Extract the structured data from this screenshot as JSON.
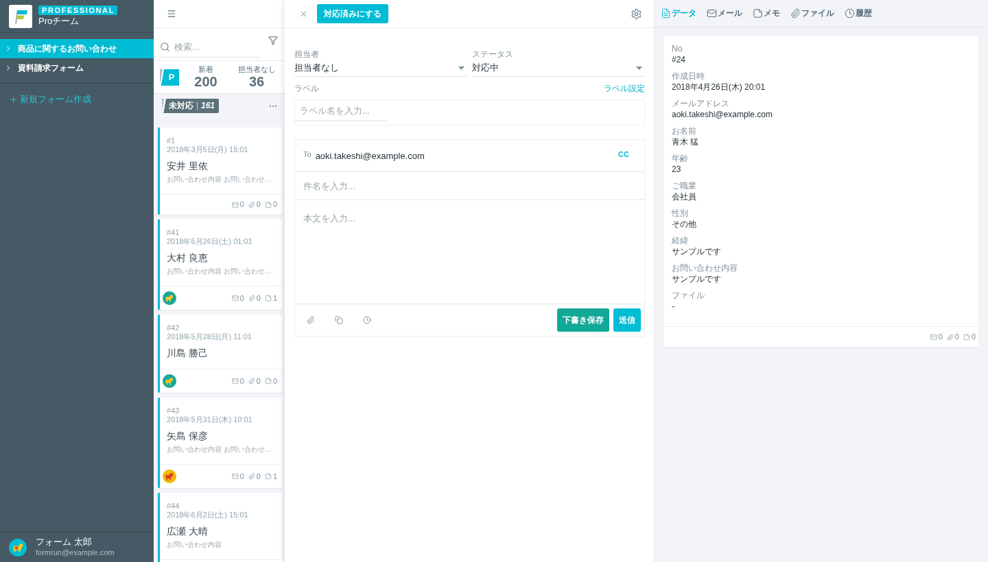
{
  "sidebar": {
    "badge": "PROFESSIONAL",
    "team": "Proチーム",
    "forms": [
      {
        "label": "商品に関するお問い合わせ",
        "selected": true
      },
      {
        "label": "資料請求フォーム",
        "selected": false
      }
    ],
    "new_form": "新規フォーム作成",
    "user": {
      "name": "フォーム 太郎",
      "email": "formrun@example.com"
    }
  },
  "list": {
    "search": {
      "placeholder": "検索..."
    },
    "project_badge": "P",
    "stats": [
      {
        "label": "新着",
        "value": "200"
      },
      {
        "label": "担当者なし",
        "value": "36"
      }
    ],
    "status_tag": {
      "label": "未対応",
      "count": "161"
    },
    "cards": [
      {
        "number": "#1",
        "date": "2018年3月5日(月) 15:01",
        "name": "安井 里依",
        "preview": "お問い合わせ内容 お問い合わせ…",
        "counts": {
          "mails": "0",
          "files": "0",
          "memos": "0"
        }
      },
      {
        "number": "#41",
        "date": "2018年5月26日(土) 01:01",
        "name": "大村 良恵",
        "preview": "お問い合わせ内容 お問い合わせ…",
        "avatar": {
          "color": "#16a89a"
        },
        "counts": {
          "mails": "0",
          "files": "0",
          "memos": "1"
        }
      },
      {
        "number": "#42",
        "date": "2018年5月28日(月) 11:01",
        "name": "川島 勝己",
        "avatar": {
          "color": "#16a89a"
        },
        "counts": {
          "mails": "0",
          "files": "0",
          "memos": "0"
        }
      },
      {
        "number": "#43",
        "date": "2018年5月31日(木) 10:01",
        "name": "矢島 保彦",
        "preview": "お問い合わせ内容 お問い合わせ…",
        "avatar": {
          "color": "#f2b705"
        },
        "counts": {
          "mails": "0",
          "files": "0",
          "memos": "1"
        }
      },
      {
        "number": "#44",
        "date": "2018年6月2日(土) 15:01",
        "name": "広瀬 大晴",
        "preview": "お問い合わせ内容"
      }
    ]
  },
  "detail": {
    "complete_button": "対応済みにする",
    "assignee": {
      "label": "担当者",
      "value": "担当者なし"
    },
    "status": {
      "label": "ステータス",
      "value": "対応中"
    },
    "labels": {
      "title": "ラベル",
      "settings_link": "ラベル設定",
      "placeholder": "ラベル名を入力..."
    },
    "compose": {
      "to_label": "To",
      "to": "aoki.takeshi@example.com",
      "cc": "CC",
      "subject_placeholder": "件名を入力...",
      "body_placeholder": "本文を入力...",
      "buttons": [
        {
          "label": "下書き保存",
          "kind": "draft"
        },
        {
          "label": "送信",
          "kind": "send"
        }
      ]
    }
  },
  "record": {
    "tabs": [
      {
        "label": "データ",
        "kind": "data",
        "selected": true
      },
      {
        "label": "メール",
        "kind": "mail",
        "selected": false
      },
      {
        "label": "メモ",
        "kind": "memo",
        "selected": false
      },
      {
        "label": "ファイル",
        "kind": "file",
        "selected": false
      },
      {
        "label": "履歴",
        "kind": "history",
        "selected": false
      }
    ],
    "fields": [
      {
        "label": "No",
        "value": "#24"
      },
      {
        "label": "作成日時",
        "value": "2018年4月26日(木) 20:01"
      },
      {
        "label": "メールアドレス",
        "value": "aoki.takeshi@example.com"
      },
      {
        "label": "お名前",
        "value": "青木 猛"
      },
      {
        "label": "年齢",
        "value": "23"
      },
      {
        "label": "ご職業",
        "value": "会社員"
      },
      {
        "label": "性別",
        "value": "その他"
      },
      {
        "label": "経緯",
        "value": "サンプルです"
      },
      {
        "label": "お問い合わせ内容",
        "value": "サンプルです"
      },
      {
        "label": "ファイル",
        "value": "-"
      }
    ],
    "counts": {
      "mails": "0",
      "files": "0",
      "memos": "0"
    }
  }
}
